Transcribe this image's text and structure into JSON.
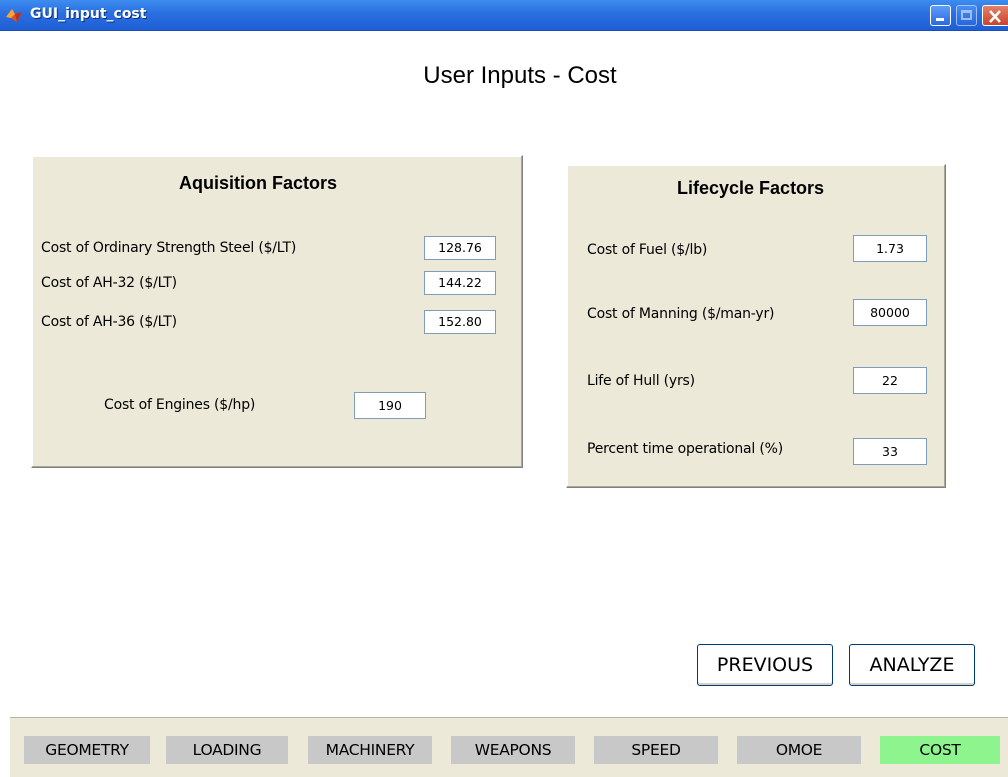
{
  "window": {
    "title": "GUI_input_cost",
    "controls": {
      "minimize": "minimize-icon",
      "maximize": "maximize-icon",
      "close": "close-icon"
    }
  },
  "page": {
    "title": "User Inputs - Cost"
  },
  "acquisition": {
    "title": "Aquisition Factors",
    "ordinary_steel": {
      "label": "Cost of Ordinary Strength Steel ($/LT)",
      "value": "128.76"
    },
    "ah32": {
      "label": "Cost of AH-32 ($/LT)",
      "value": "144.22"
    },
    "ah36": {
      "label": "Cost of AH-36 ($/LT)",
      "value": "152.80"
    },
    "engines": {
      "label": "Cost of Engines ($/hp)",
      "value": "190"
    }
  },
  "lifecycle": {
    "title": "Lifecycle Factors",
    "fuel": {
      "label": "Cost of Fuel ($/lb)",
      "value": "1.73"
    },
    "manning": {
      "label": "Cost of Manning ($/man-yr)",
      "value": "80000"
    },
    "hull_life": {
      "label": "Life of Hull (yrs)",
      "value": "22"
    },
    "operational": {
      "label": "Percent time operational (%)",
      "value": "33"
    }
  },
  "buttons": {
    "previous": "PREVIOUS",
    "analyze": "ANALYZE"
  },
  "tabs": [
    "GEOMETRY",
    "LOADING",
    "MACHINERY",
    "WEAPONS",
    "SPEED",
    "OMOE",
    "COST"
  ],
  "active_tab": "COST",
  "colors": {
    "titlebar": "#2a6fe0",
    "panel": "#ece9d8",
    "tab": "#c8c8c8",
    "active_tab": "#8ef58e"
  }
}
